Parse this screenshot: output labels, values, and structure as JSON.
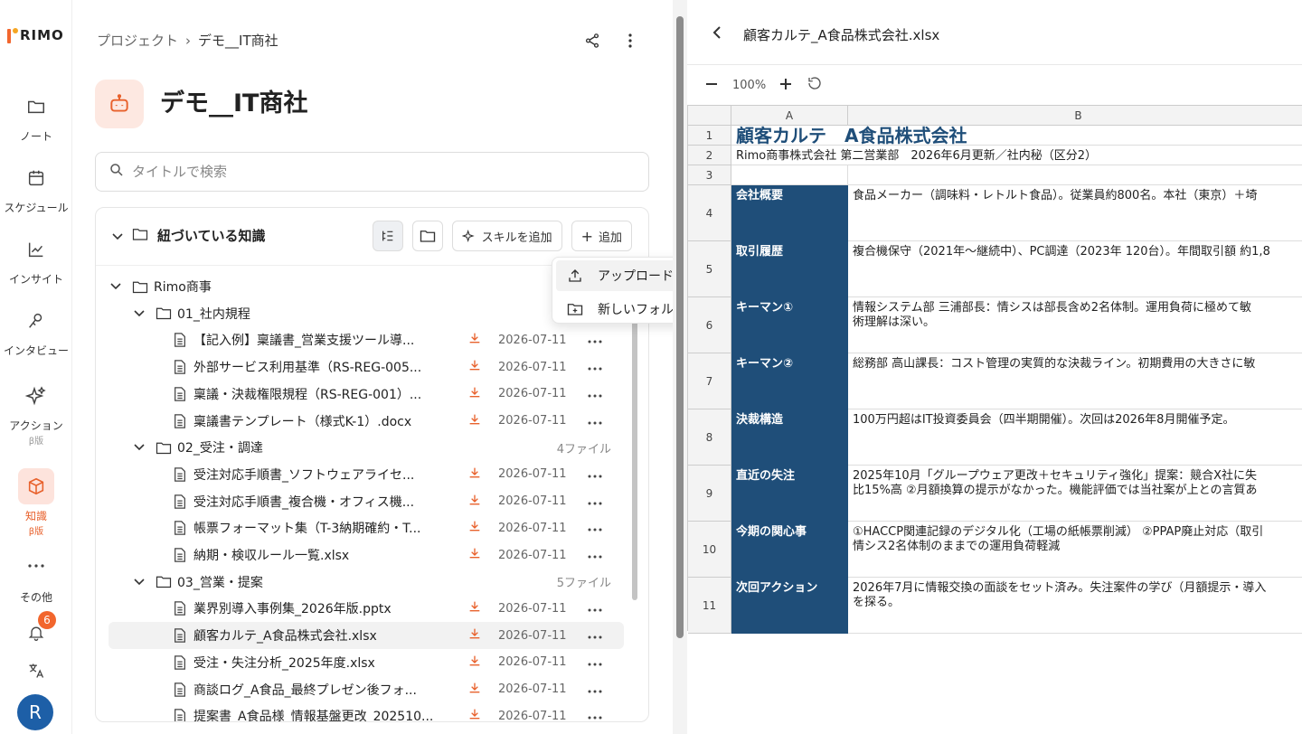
{
  "app": {
    "logo_text": "RIMO",
    "brand_color": "#e8612c"
  },
  "rail": {
    "items": [
      {
        "label": "ノート",
        "icon": "folder-icon"
      },
      {
        "label": "スケジュール",
        "icon": "calendar-icon"
      },
      {
        "label": "インサイト",
        "icon": "chart-icon"
      },
      {
        "label": "インタビュー",
        "icon": "interview-icon"
      },
      {
        "label": "アクション",
        "sub": "β版",
        "icon": "sparkle-icon"
      },
      {
        "label": "知識",
        "sub": "β版",
        "icon": "knowledge-icon"
      },
      {
        "label": "その他",
        "icon": "more-icon"
      }
    ],
    "notification_count": "6",
    "avatar_initial": "R"
  },
  "breadcrumb": {
    "root": "プロジェクト",
    "separator": "›",
    "current": "デモ__IT商社"
  },
  "project": {
    "title": "デモ__IT商社"
  },
  "search": {
    "placeholder": "タイトルで検索"
  },
  "knowledge": {
    "header": "紐づいている知識",
    "add_skill": "スキルを追加",
    "add": "追加",
    "menu": {
      "upload": "アップロード",
      "new_folder": "新しいフォルダ"
    },
    "root_folder": "Rimo商事",
    "folders": [
      {
        "name": "01_社内規程",
        "count": ""
      },
      {
        "name": "02_受注・調達",
        "count": "4ファイル"
      },
      {
        "name": "03_営業・提案",
        "count": "5ファイル"
      }
    ],
    "files": [
      {
        "name": "【記入例】稟議書_営業支援ツール導...",
        "date": "2026-07-11"
      },
      {
        "name": "外部サービス利用基準（RS-REG-005...",
        "date": "2026-07-11"
      },
      {
        "name": "稟議・決裁権限規程（RS-REG-001）...",
        "date": "2026-07-11"
      },
      {
        "name": "稟議書テンプレート（様式K-1）.docx",
        "date": "2026-07-11"
      },
      {
        "name": "受注対応手順書_ソフトウェアライセ...",
        "date": "2026-07-11"
      },
      {
        "name": "受注対応手順書_複合機・オフィス機...",
        "date": "2026-07-11"
      },
      {
        "name": "帳票フォーマット集（T-3納期確約・T...",
        "date": "2026-07-11"
      },
      {
        "name": "納期・検収ルール一覧.xlsx",
        "date": "2026-07-11"
      },
      {
        "name": "業界別導入事例集_2026年版.pptx",
        "date": "2026-07-11"
      },
      {
        "name": "顧客カルテ_A食品株式会社.xlsx",
        "date": "2026-07-11"
      },
      {
        "name": "受注・失注分析_2025年度.xlsx",
        "date": "2026-07-11"
      },
      {
        "name": "商談ログ_A食品_最終プレゼン後フォ...",
        "date": "2026-07-11"
      },
      {
        "name": "提案書_A食品様_情報基盤更改_202510...",
        "date": "2026-07-11"
      }
    ]
  },
  "viewer": {
    "title": "顧客カルテ_A食品株式会社.xlsx",
    "zoom": "100%",
    "columns": [
      "A",
      "B"
    ],
    "rows": [
      {
        "num": "1",
        "a": "顧客カルテ　A食品株式会社",
        "b": ""
      },
      {
        "num": "2",
        "a": "Rimo商事株式会社 第二営業部　2026年6月更新／社内秘（区分2）",
        "b": ""
      },
      {
        "num": "3",
        "a": "",
        "b": ""
      },
      {
        "num": "4",
        "a": "会社概要",
        "b": "食品メーカー（調味料・レトルト食品）。従業員約800名。本社（東京）＋埼"
      },
      {
        "num": "5",
        "a": "取引履歴",
        "b": "複合機保守（2021年〜継続中）、PC調達（2023年 120台）。年間取引額 約1,8"
      },
      {
        "num": "6",
        "a": "キーマン①",
        "b": "情報システム部 三浦部長：情シスは部長含め2名体制。運用負荷に極めて敏\n術理解は深い。"
      },
      {
        "num": "7",
        "a": "キーマン②",
        "b": "総務部 高山課長：コスト管理の実質的な決裁ライン。初期費用の大きさに敏"
      },
      {
        "num": "8",
        "a": "決裁構造",
        "b": "100万円超はIT投資委員会（四半期開催）。次回は2026年8月開催予定。"
      },
      {
        "num": "9",
        "a": "直近の失注",
        "b": "2025年10月「グループウェア更改＋セキュリティ強化」提案：競合X社に失\n比15%高 ②月額換算の提示がなかった。機能評価では当社案が上との言質あ"
      },
      {
        "num": "10",
        "a": "今期の関心事",
        "b": "①HACCP関連記録のデジタル化（工場の紙帳票削減） ②PPAP廃止対応（取引\n情シス2名体制のままでの運用負荷軽減"
      },
      {
        "num": "11",
        "a": "次回アクション",
        "b": "2026年7月に情報交換の面談をセット済み。失注案件の学び（月額提示・導入\nを探る。"
      }
    ]
  }
}
